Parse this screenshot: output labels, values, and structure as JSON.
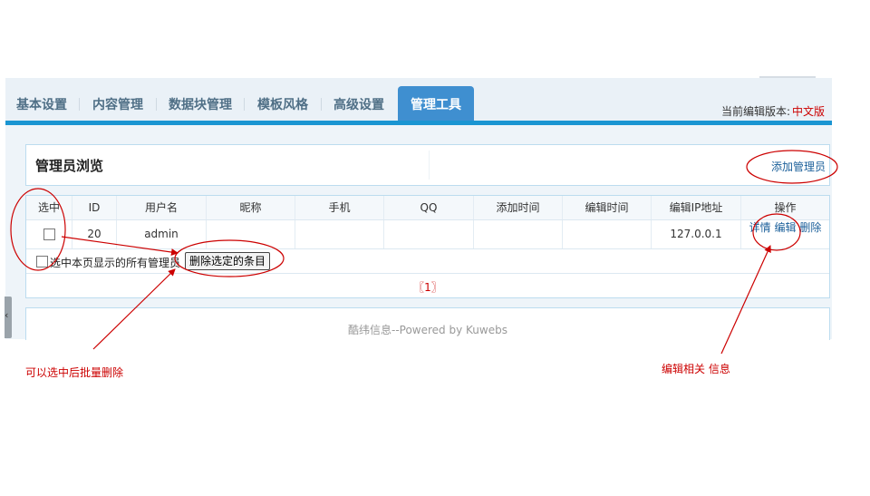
{
  "nav": {
    "tabs": [
      {
        "label": "基本设置"
      },
      {
        "label": "内容管理"
      },
      {
        "label": "数据块管理"
      },
      {
        "label": "模板风格"
      },
      {
        "label": "高级设置"
      },
      {
        "label": "管理工具"
      }
    ],
    "active_tab": "管理工具",
    "version_label": "当前编辑版本:",
    "version_value": "中文版"
  },
  "panel": {
    "title": "管理员浏览",
    "add_link": "添加管理员"
  },
  "table": {
    "headers": [
      "选中",
      "ID",
      "用户名",
      "昵称",
      "手机",
      "QQ",
      "添加时间",
      "编辑时间",
      "编辑IP地址",
      "操作"
    ],
    "rows": [
      {
        "id": "20",
        "username": "admin",
        "nickname": "",
        "phone": "",
        "qq": "",
        "add_time": "",
        "edit_time": "",
        "ip": "127.0.0.1",
        "actions": [
          "详情",
          "编辑",
          "删除"
        ]
      }
    ],
    "select_all_label": "选中本页显示的所有管理员",
    "delete_button": "删除选定的条目",
    "pagination": "〖1〗"
  },
  "footer": {
    "text": "酷纬信息--Powered by Kuwebs"
  },
  "annotations": {
    "batch_delete_note": "可以选中后批量删除",
    "edit_note": "编辑相关 信息"
  },
  "colors": {
    "accent": "#1a95d2",
    "annotation": "#cc0000",
    "link": "#1a5f9a"
  },
  "icons": {
    "side_handle": "chevron-left-icon"
  }
}
